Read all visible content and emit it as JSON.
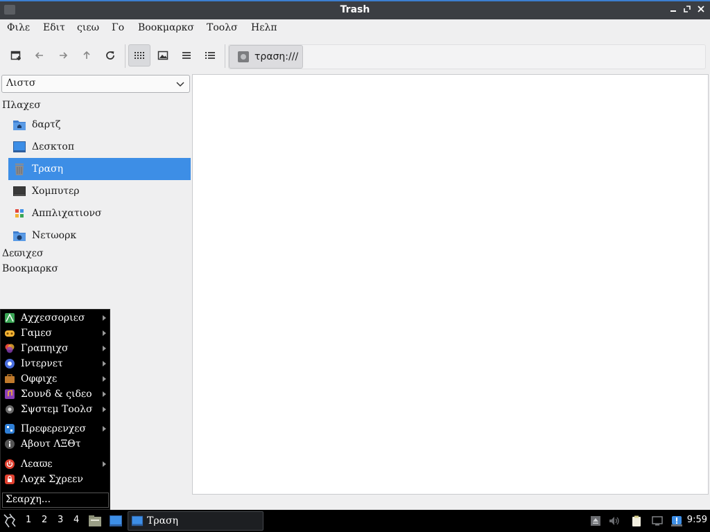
{
  "window": {
    "title": "Trash"
  },
  "menubar": [
    "Φιλε",
    "Εδιτ",
    "ςιεω",
    "Γο",
    "Βοοκμαρκσ",
    "Τοολσ",
    "Ηελπ"
  ],
  "toolbar": {
    "buttons": [
      "new-tab-icon",
      "back-icon",
      "forward-icon",
      "up-icon",
      "reload-icon",
      "icon-view-icon",
      "thumbnail-view-icon",
      "compact-view-icon",
      "detailed-list-icon"
    ],
    "active_view": "icon-view",
    "location": "τραση:///"
  },
  "sidepane": {
    "mode": "Λιστσ",
    "places_heading": "Πλαχεσ",
    "places": [
      {
        "label": "δαρτζ",
        "icon": "home-folder-icon"
      },
      {
        "label": "Δεσκτοπ",
        "icon": "desktop-icon"
      },
      {
        "label": "Τραση",
        "icon": "trash-icon",
        "selected": true
      },
      {
        "label": "Χομπυτερ",
        "icon": "computer-icon"
      },
      {
        "label": "Αππλιχατιονσ",
        "icon": "applications-icon"
      },
      {
        "label": "Νετωορκ",
        "icon": "network-icon"
      }
    ],
    "devices_heading": "Δεϖιχεσ",
    "bookmarks_heading": "Βοοκμαρκσ"
  },
  "start_menu": {
    "items": [
      {
        "label": "Αχχεσσοριεσ",
        "icon": "accessories-icon",
        "submenu": true,
        "color": "#3aa655"
      },
      {
        "label": "Γαμεσ",
        "icon": "games-icon",
        "submenu": true,
        "color": "#f2b233"
      },
      {
        "label": "Γραπηιχσ",
        "icon": "graphics-icon",
        "submenu": true,
        "color": "#e04f8c"
      },
      {
        "label": "Ιντερνετ",
        "icon": "internet-icon",
        "submenu": true,
        "color": "#4a6fe0"
      },
      {
        "label": "Οφφιχε",
        "icon": "office-icon",
        "submenu": true,
        "color": "#c07a2c"
      },
      {
        "label": "Σουνδ & ςιδεο",
        "icon": "sound-video-icon",
        "submenu": true,
        "color": "#8a3fb8"
      },
      {
        "label": "Σψστεμ Τοολσ",
        "icon": "system-tools-icon",
        "submenu": true,
        "color": "#6a6a6a"
      },
      {
        "label": "Πρεφερενχεσ",
        "icon": "preferences-icon",
        "submenu": true,
        "color": "#2f7fd6"
      },
      {
        "label": "Αβουτ ΛΞΘτ",
        "icon": "about-icon",
        "submenu": false,
        "color": "#555555"
      },
      {
        "label": "Λεαϖε",
        "icon": "leave-icon",
        "submenu": true,
        "color": "#e0402f"
      },
      {
        "label": "Λοχκ Σχρεεν",
        "icon": "lock-screen-icon",
        "submenu": false,
        "color": "#e0402f"
      }
    ],
    "search_placeholder": "Σεαρχη..."
  },
  "taskbar": {
    "workspaces": [
      "1",
      "2",
      "3",
      "4"
    ],
    "task_label": "Τραση",
    "clock": "9:59"
  },
  "colors": {
    "accent": "#3d8ee6",
    "titlebar": "#3b3e43",
    "taskbar": "#000000"
  }
}
